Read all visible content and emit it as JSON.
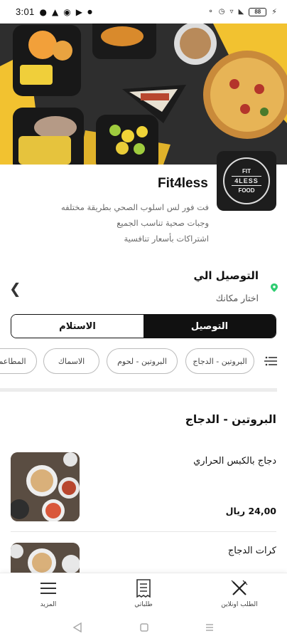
{
  "status_bar": {
    "time": "3:01",
    "battery": "88"
  },
  "restaurant": {
    "name": "Fit4less",
    "logo_text_top": "FIT",
    "logo_text_mid": "4LESS",
    "logo_text_bottom": "FOOD",
    "description": [
      "فت فور لس اسلوب الصحي بطريقة مختلفه",
      "وجبات صحية تناسب الجميع",
      "اشتراكات بأسعار تنافسية"
    ]
  },
  "delivery": {
    "title": "التوصيل الي",
    "subtitle": "اختار مكانك"
  },
  "order_mode": {
    "delivery_label": "التوصيل",
    "pickup_label": "الاستلام",
    "selected": "delivery"
  },
  "categories": [
    "البروتين - الدجاج",
    "البروتين - لحوم",
    "الاسماك",
    "المطاعم"
  ],
  "section": {
    "title": "البروتين - الدجاج"
  },
  "items": [
    {
      "name": "دجاج بالكبس الحراري",
      "price": "24,00 ريال"
    },
    {
      "name": "كرات الدجاج",
      "price": ""
    }
  ],
  "bottom_nav": [
    {
      "label": "المزيد",
      "icon": "menu-icon"
    },
    {
      "label": "طلباتي",
      "icon": "receipt-icon"
    },
    {
      "label": "الطلب اونلاين",
      "icon": "utensils-icon"
    }
  ],
  "colors": {
    "primary": "#111111",
    "accent_pin": "#2ecc71",
    "cover_yellow": "#f2c230"
  }
}
